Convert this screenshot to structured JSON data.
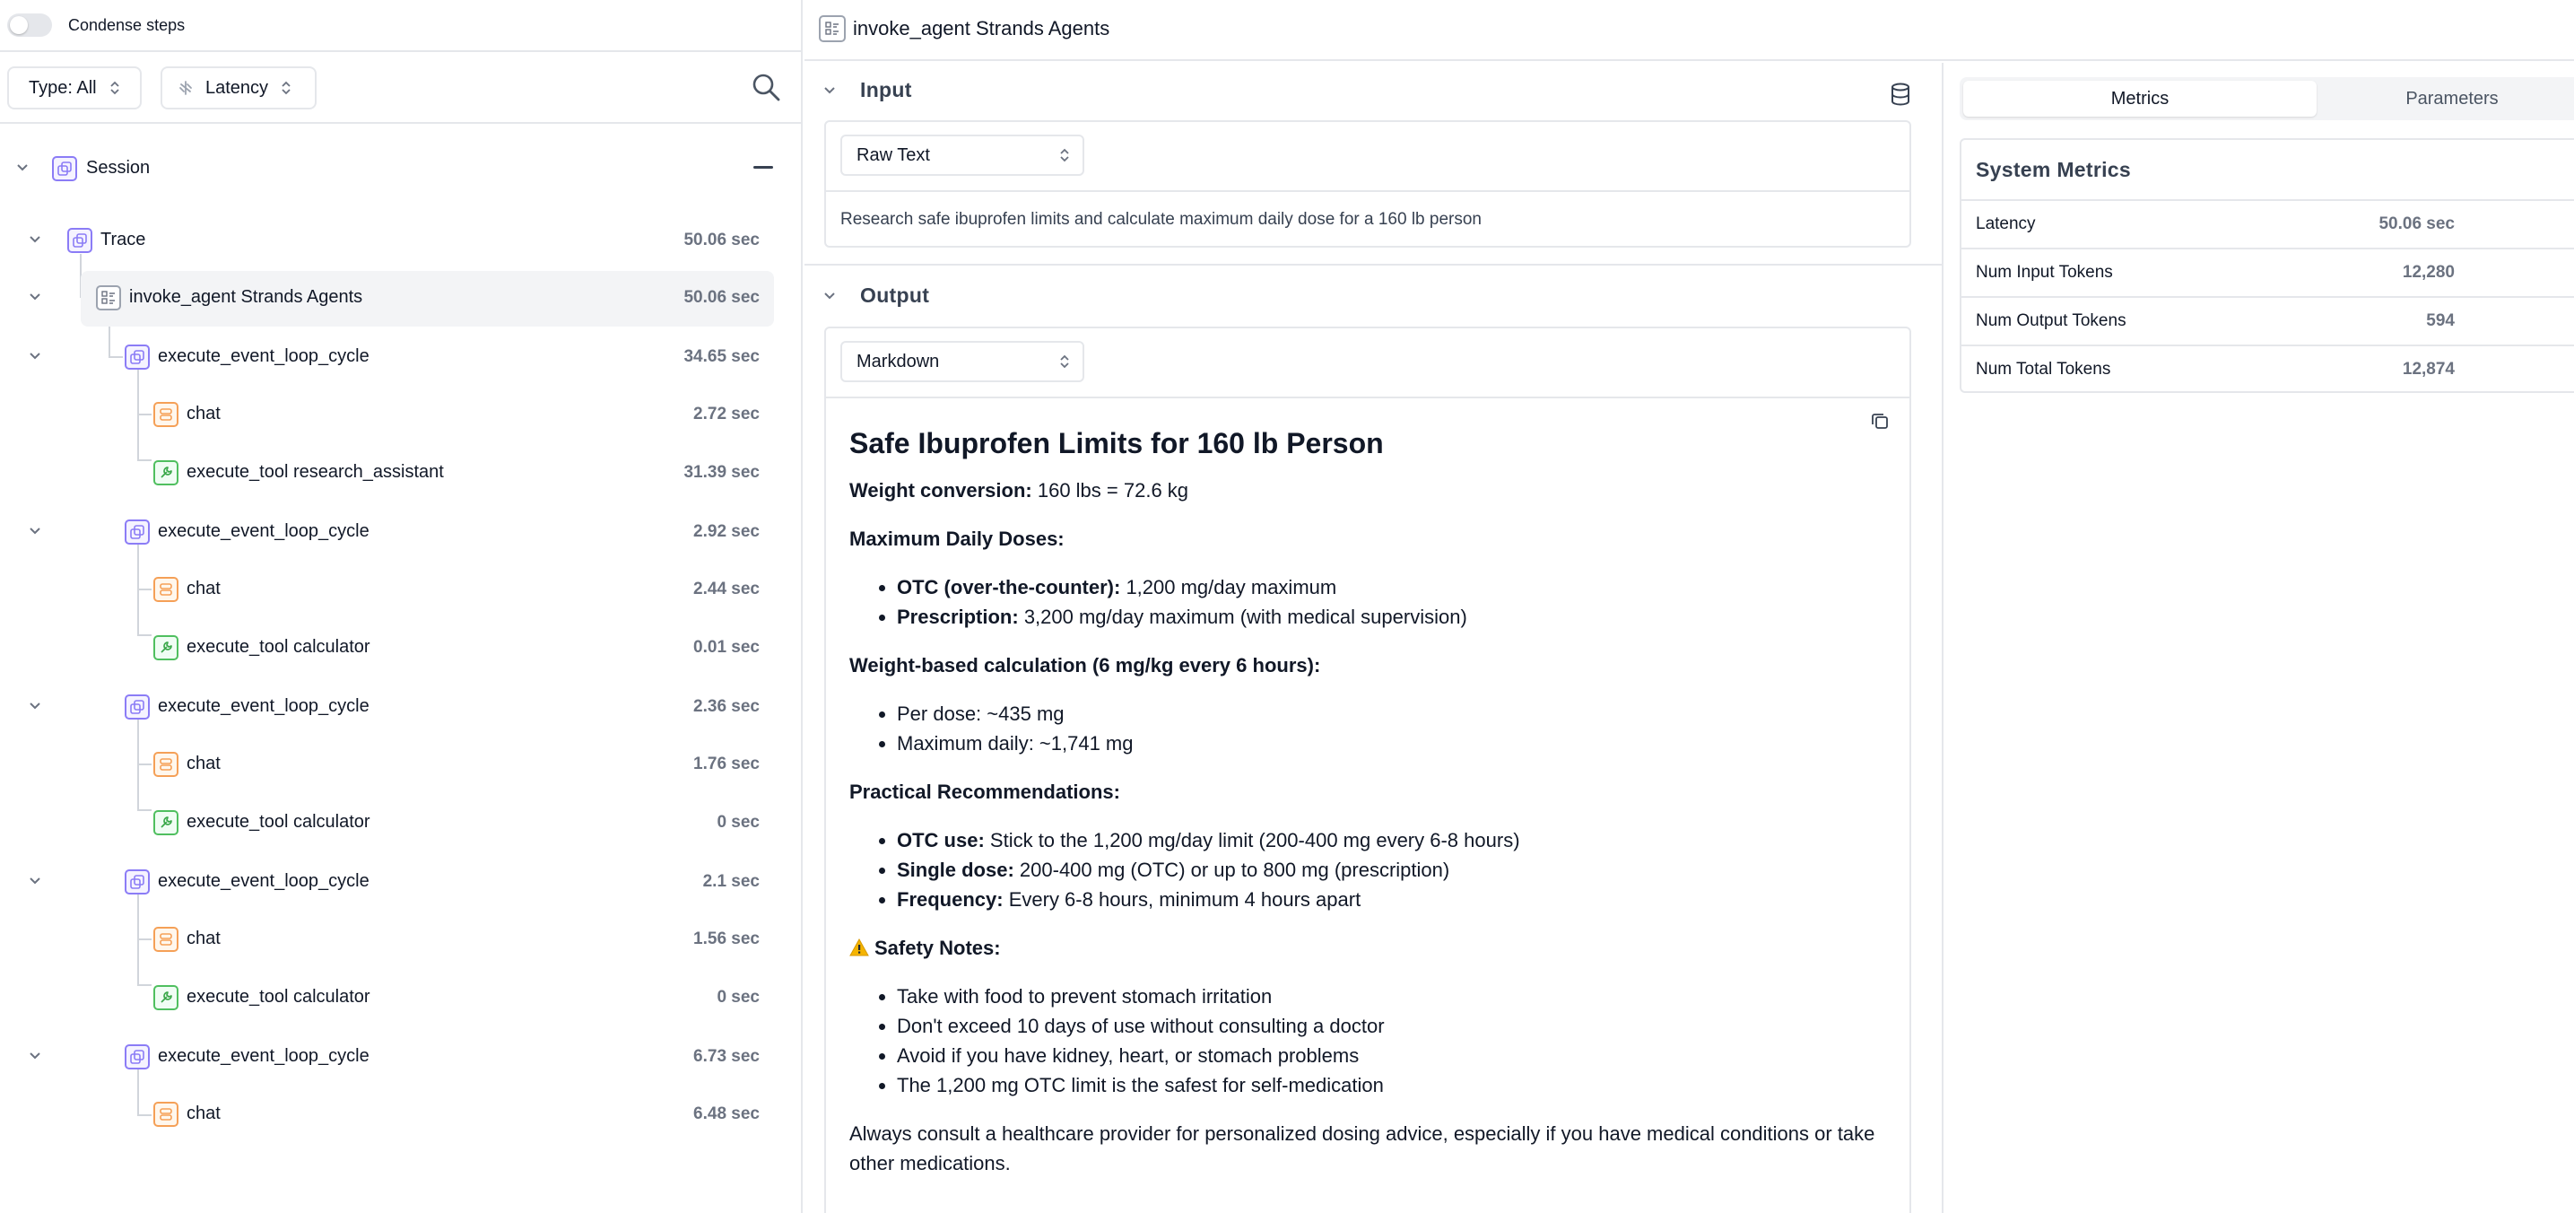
{
  "topbar": {
    "condense_label": "Condense steps",
    "condense_on": false
  },
  "filters": {
    "type_label": "Type: All",
    "latency_label": "Latency"
  },
  "tree": {
    "session_label": "Session",
    "nodes": [
      {
        "label": "Trace",
        "time": "50.06 sec",
        "icon": "trace-icon",
        "level": 1
      },
      {
        "label": "invoke_agent Strands Agents",
        "time": "50.06 sec",
        "icon": "agent-icon",
        "level": 2,
        "selected": true
      },
      {
        "label": "execute_event_loop_cycle",
        "time": "34.65 sec",
        "icon": "loop-icon",
        "level": 3
      },
      {
        "label": "chat",
        "time": "2.72 sec",
        "icon": "llm-icon",
        "level": 4
      },
      {
        "label": "execute_tool research_assistant",
        "time": "31.39 sec",
        "icon": "tool-icon",
        "level": 4
      },
      {
        "label": "execute_event_loop_cycle",
        "time": "2.92 sec",
        "icon": "loop-icon",
        "level": 3
      },
      {
        "label": "chat",
        "time": "2.44 sec",
        "icon": "llm-icon",
        "level": 4
      },
      {
        "label": "execute_tool calculator",
        "time": "0.01 sec",
        "icon": "tool-icon",
        "level": 4
      },
      {
        "label": "execute_event_loop_cycle",
        "time": "2.36 sec",
        "icon": "loop-icon",
        "level": 3
      },
      {
        "label": "chat",
        "time": "1.76 sec",
        "icon": "llm-icon",
        "level": 4
      },
      {
        "label": "execute_tool calculator",
        "time": "0 sec",
        "icon": "tool-icon",
        "level": 4
      },
      {
        "label": "execute_event_loop_cycle",
        "time": "2.1 sec",
        "icon": "loop-icon",
        "level": 3
      },
      {
        "label": "chat",
        "time": "1.56 sec",
        "icon": "llm-icon",
        "level": 4
      },
      {
        "label": "execute_tool calculator",
        "time": "0 sec",
        "icon": "tool-icon",
        "level": 4
      },
      {
        "label": "execute_event_loop_cycle",
        "time": "6.73 sec",
        "icon": "loop-icon",
        "level": 3
      },
      {
        "label": "chat",
        "time": "6.48 sec",
        "icon": "llm-icon",
        "level": 4
      }
    ]
  },
  "detail": {
    "title": "invoke_agent Strands Agents",
    "input": {
      "heading": "Input",
      "format": "Raw Text",
      "text": "Research safe ibuprofen limits and calculate maximum daily dose for a 160 lb person"
    },
    "output": {
      "heading": "Output",
      "format": "Markdown",
      "h1": "Safe Ibuprofen Limits for 160 lb Person",
      "weight_label": "Weight conversion:",
      "weight_value": " 160 lbs = 72.6 kg",
      "max_heading": "Maximum Daily Doses:",
      "max_items": [
        {
          "b": "OTC (over-the-counter):",
          "t": " 1,200 mg/day maximum"
        },
        {
          "b": "Prescription:",
          "t": " 3,200 mg/day maximum (with medical supervision)"
        }
      ],
      "calc_heading": "Weight-based calculation (6 mg/kg every 6 hours):",
      "calc_items": [
        "Per dose: ~435 mg",
        "Maximum daily: ~1,741 mg"
      ],
      "prac_heading": "Practical Recommendations:",
      "prac_items": [
        {
          "b": "OTC use:",
          "t": " Stick to the 1,200 mg/day limit (200-400 mg every 6-8 hours)"
        },
        {
          "b": "Single dose:",
          "t": " 200-400 mg (OTC) or up to 800 mg (prescription)"
        },
        {
          "b": "Frequency:",
          "t": " Every 6-8 hours, minimum 4 hours apart"
        }
      ],
      "safety_heading": "Safety Notes:",
      "safety_items": [
        "Take with food to prevent stomach irritation",
        "Don't exceed 10 days of use without consulting a doctor",
        "Avoid if you have kidney, heart, or stomach problems",
        "The 1,200 mg OTC limit is the safest for self-medication"
      ],
      "closing": "Always consult a healthcare provider for personalized dosing advice, especially if you have medical conditions or take other medications."
    }
  },
  "sidebar": {
    "tabs": [
      "Metrics",
      "Parameters"
    ],
    "active_tab": "Metrics",
    "metrics_title": "System Metrics",
    "metrics": [
      {
        "label": "Latency",
        "value": "50.06 sec"
      },
      {
        "label": "Num Input Tokens",
        "value": "12,280"
      },
      {
        "label": "Num Output Tokens",
        "value": "594"
      },
      {
        "label": "Num Total Tokens",
        "value": "12,874"
      }
    ]
  },
  "colors": {
    "loop": "#8b7cf6",
    "llm": "#f5a057",
    "tool": "#4fbf5f",
    "agent": "#9ca3af",
    "border": "#e5e7eb"
  }
}
